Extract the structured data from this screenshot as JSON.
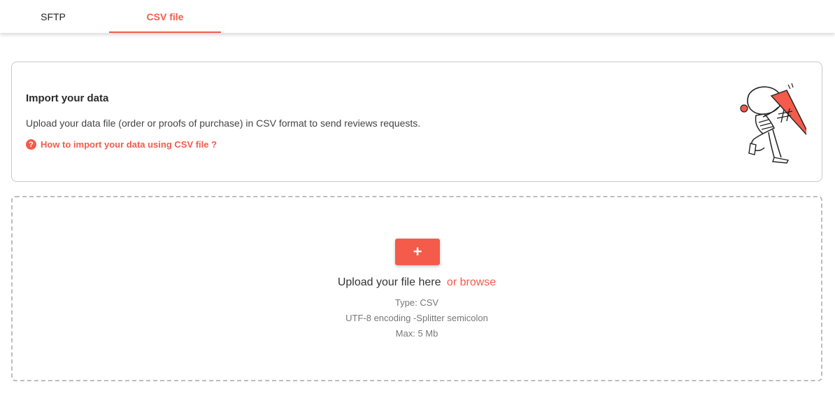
{
  "tabs": [
    {
      "label": "SFTP",
      "active": false
    },
    {
      "label": "CSV file",
      "active": true
    }
  ],
  "colors": {
    "accent": "#f45b4b",
    "border": "#c8c8c8",
    "dash": "#bdbdbd"
  },
  "info": {
    "title": "Import your data",
    "description": "Upload your data file (order or proofs of purchase) in CSV format to send reviews requests.",
    "help_icon": "question-circle-icon",
    "help_icon_glyph": "?",
    "help_link": "How to import your data using CSV file ?",
    "illustration": "person-carrying-hashtag-illustration"
  },
  "upload": {
    "add_button": "+",
    "prompt": "Upload your file here",
    "browse": "or browse",
    "type": "Type: CSV",
    "encoding": "UTF-8 encoding -Splitter semicolon",
    "max": "Max: 5 Mb"
  }
}
